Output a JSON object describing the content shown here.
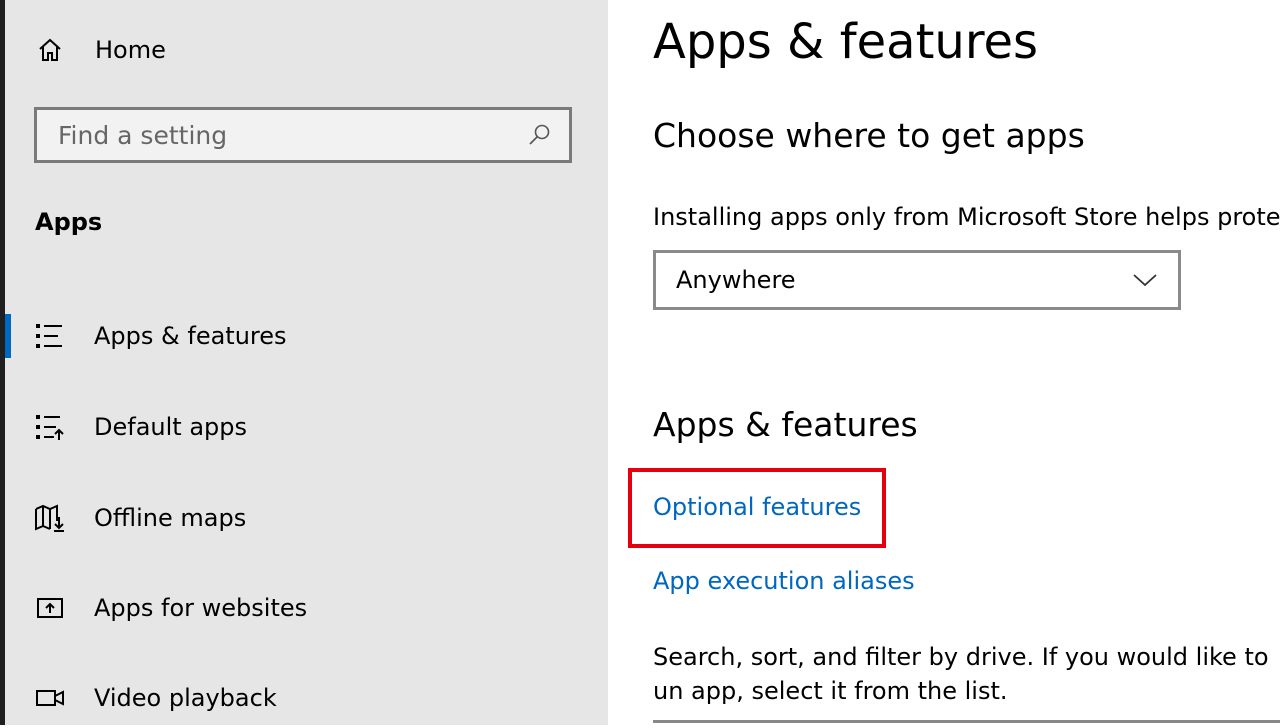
{
  "sidebar": {
    "home_label": "Home",
    "search_placeholder": "Find a setting",
    "section_title": "Apps",
    "items": [
      {
        "label": "Apps & features",
        "icon": "list-icon",
        "selected": true
      },
      {
        "label": "Default apps",
        "icon": "default-apps-icon",
        "selected": false
      },
      {
        "label": "Offline maps",
        "icon": "map-download-icon",
        "selected": false
      },
      {
        "label": "Apps for websites",
        "icon": "open-in-app-icon",
        "selected": false
      },
      {
        "label": "Video playback",
        "icon": "video-icon",
        "selected": false
      }
    ]
  },
  "main": {
    "title": "Apps & features",
    "choose_heading": "Choose where to get apps",
    "choose_desc": "Installing apps only from Microsoft Store helps protec",
    "dropdown_value": "Anywhere",
    "section_heading": "Apps & features",
    "link_optional": "Optional features",
    "link_aliases": "App execution aliases",
    "search_desc": "Search, sort, and filter by drive. If you would like to un app, select it from the list."
  },
  "colors": {
    "accent": "#0067c0",
    "highlight_box": "#e6000f",
    "sidebar_bg": "#e6e6e6"
  }
}
